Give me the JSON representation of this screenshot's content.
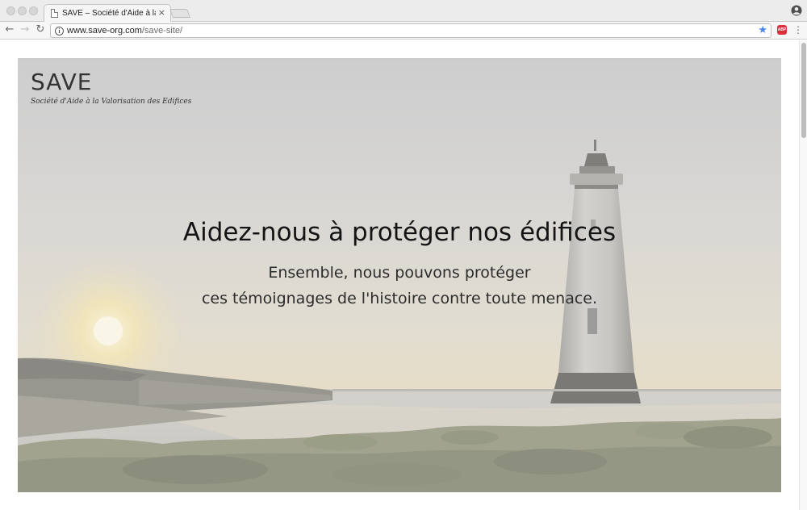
{
  "browser": {
    "tab_title": "SAVE – Société d'Aide à la Valorisation des Edifices",
    "tab_close": "×",
    "url_host": "www.save-org.com",
    "url_path": "/save-site/",
    "adblock_label": "ABP"
  },
  "site": {
    "title": "SAVE",
    "tagline": "Société d'Aide à la Valorisation des Edifices"
  },
  "hero": {
    "heading": "Aidez-nous à protéger nos édifices",
    "subtitle_line1": "Ensemble, nous pouvons protéger",
    "subtitle_line2": "ces témoignages de l'histoire contre toute menace."
  },
  "icons": {
    "tab": "document-icon",
    "back": "arrow-left-icon",
    "forward": "arrow-right-icon",
    "reload": "reload-icon",
    "info": "info-icon",
    "bookmark": "star-icon",
    "extension": "adblock-icon",
    "menu": "vertical-dots-icon",
    "profile": "user-profile-icon"
  },
  "colors": {
    "bookmark_star": "#4a86e8",
    "adblock": "#d9303a",
    "hero_overlay": "#e6e6e6"
  }
}
